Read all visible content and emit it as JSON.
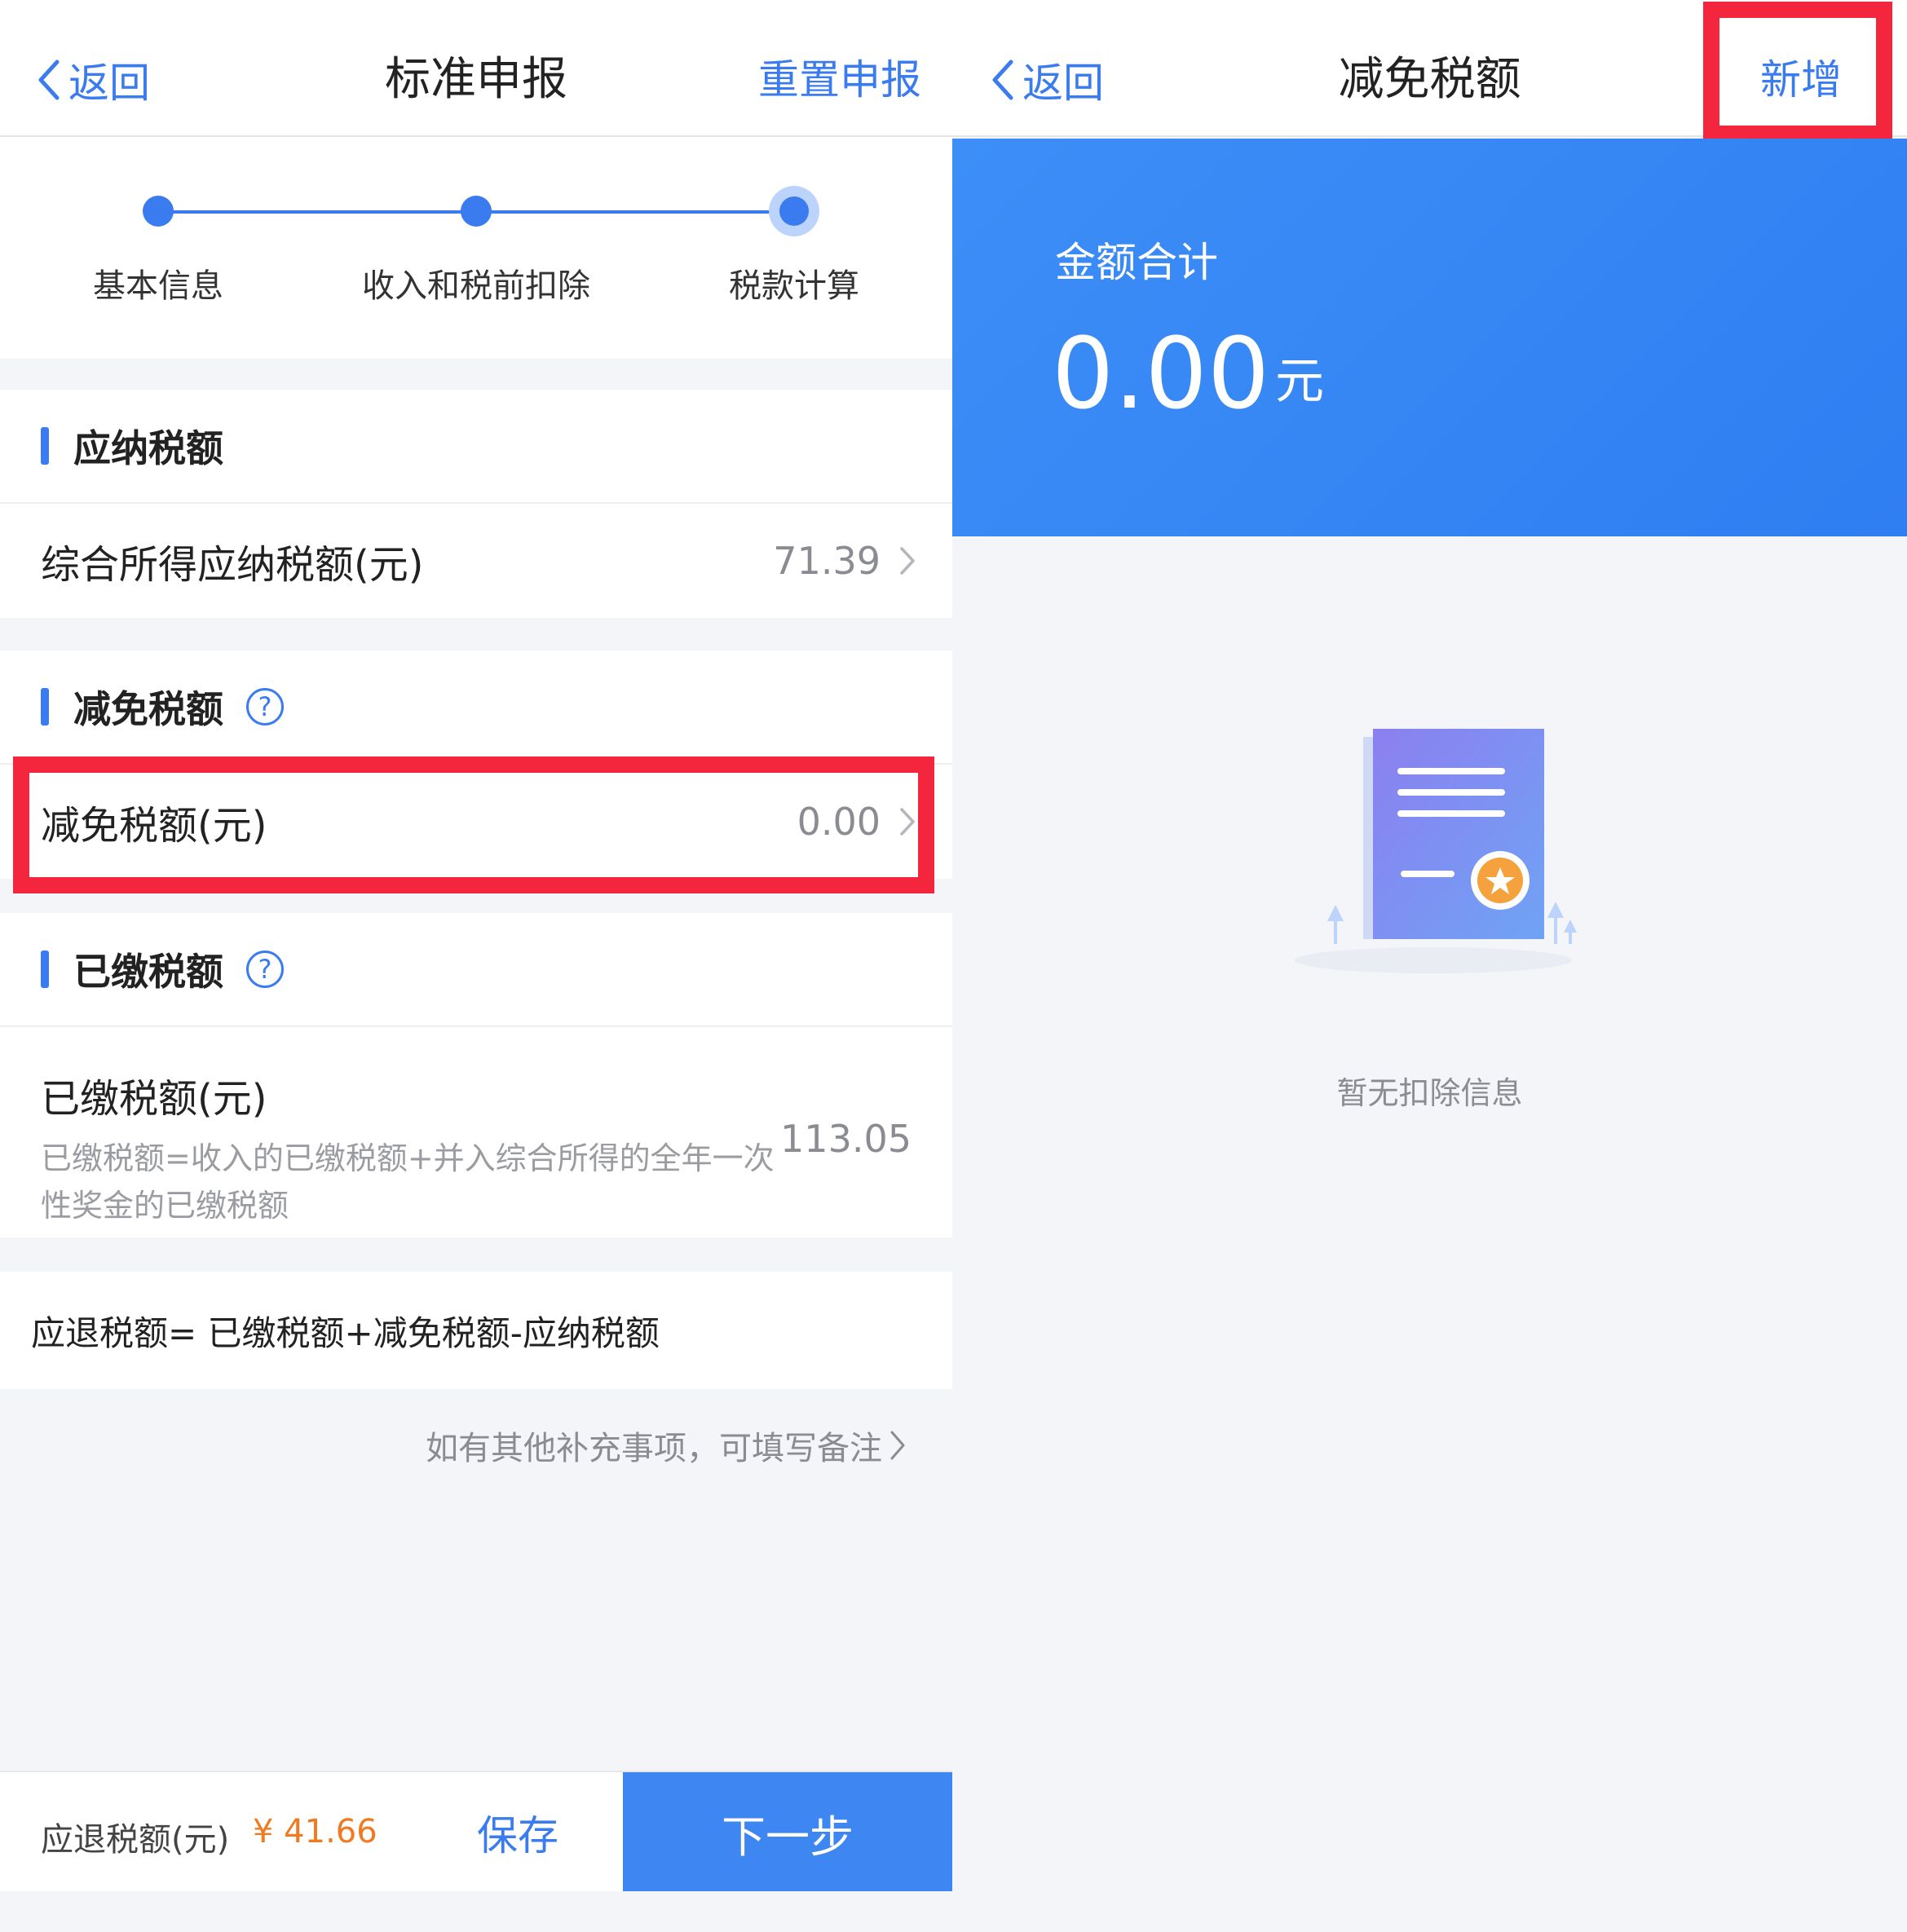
{
  "left": {
    "nav": {
      "back_label": "返回",
      "title": "标准申报",
      "action_label": "重置申报"
    },
    "steps": [
      {
        "label": "基本信息"
      },
      {
        "label": "收入和税前扣除"
      },
      {
        "label": "税款计算"
      }
    ],
    "payable": {
      "title": "应纳税额",
      "row_label": "综合所得应纳税额(元)",
      "row_value": "71.39"
    },
    "reduction": {
      "title": "减免税额",
      "row_label": "减免税额(元)",
      "row_value": "0.00"
    },
    "paid": {
      "title": "已缴税额",
      "row_label": "已缴税额(元)",
      "row_desc": "已缴税额=收入的已缴税额+并入综合所得的全年一次性奖金的已缴税额",
      "row_value": "113.05"
    },
    "formula": "应退税额= 已缴税额+减免税额-应纳税额",
    "remark": "如有其他补充事项，可填写备注",
    "bottom": {
      "refund_label": "应退税额(元)",
      "refund_value": "¥ 41.66",
      "save_label": "保存",
      "next_label": "下一步"
    }
  },
  "right": {
    "nav": {
      "back_label": "返回",
      "title": "减免税额",
      "action_label": "新增"
    },
    "summary": {
      "title": "金额合计",
      "value": "0.00",
      "unit": "元"
    },
    "empty_text": "暂无扣除信息"
  },
  "colors": {
    "accent": "#3a7cf0",
    "highlight": "#f3263e",
    "refund": "#f07a21"
  }
}
